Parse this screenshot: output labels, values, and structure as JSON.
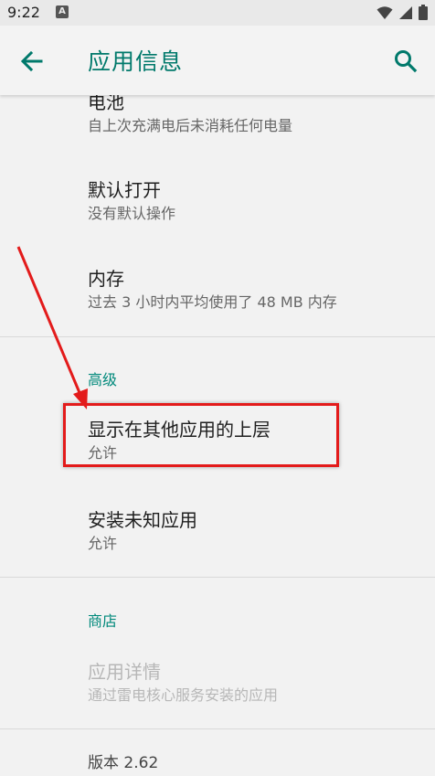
{
  "status_bar": {
    "time": "9:22",
    "notification_letter": "A"
  },
  "app_bar": {
    "title": "应用信息"
  },
  "items": {
    "battery": {
      "title": "电池",
      "subtitle": "自上次充满电后未消耗任何电量"
    },
    "default_open": {
      "title": "默认打开",
      "subtitle": "没有默认操作"
    },
    "memory": {
      "title": "内存",
      "subtitle": "过去 3 小时内平均使用了 48 MB 内存"
    }
  },
  "advanced": {
    "header": "高级",
    "overlay": {
      "title": "显示在其他应用的上层",
      "subtitle": "允许"
    },
    "install_unknown": {
      "title": "安装未知应用",
      "subtitle": "允许"
    }
  },
  "store": {
    "header": "商店",
    "app_details": {
      "title": "应用详情",
      "subtitle": "通过雷电核心服务安装的应用"
    }
  },
  "version": "版本 2.62",
  "colors": {
    "accent": "#00796b",
    "highlight": "#e31b1b",
    "background": "#f2f2f2"
  }
}
